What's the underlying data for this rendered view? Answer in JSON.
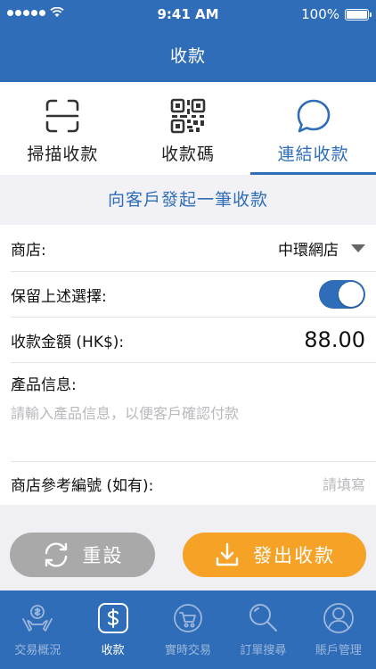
{
  "status_bar": {
    "time": "9:41 AM",
    "battery": "100%"
  },
  "nav": {
    "title": "收款"
  },
  "tabs": [
    {
      "label": "掃描收款",
      "icon": "scan-icon",
      "active": false
    },
    {
      "label": "收款碼",
      "icon": "qr-code-icon",
      "active": false
    },
    {
      "label": "連結收款",
      "icon": "chat-bubble-icon",
      "active": true
    }
  ],
  "section": {
    "title": "向客戶發起一筆收款"
  },
  "form": {
    "shop_label": "商店:",
    "shop_value": "中環網店",
    "keep_label": "保留上述選擇:",
    "keep_on": true,
    "amount_label": "收款金額 (HK$):",
    "amount_value": "88.00",
    "product_label": "產品信息:",
    "product_placeholder": "請輸入產品信息，以便客戶確認付款",
    "ref_label": "商店參考編號 (如有):",
    "ref_placeholder": "請填寫"
  },
  "buttons": {
    "reset": "重設",
    "send": "發出收款"
  },
  "tabbar": [
    {
      "label": "交易概況",
      "icon": "hand-coin-icon",
      "active": false
    },
    {
      "label": "收款",
      "icon": "dollar-card-icon",
      "active": true
    },
    {
      "label": "實時交易",
      "icon": "cart-sync-icon",
      "active": false
    },
    {
      "label": "訂單搜尋",
      "icon": "search-icon",
      "active": false
    },
    {
      "label": "賬戶管理",
      "icon": "user-icon",
      "active": false
    }
  ],
  "colors": {
    "primary": "#2f6db8",
    "accent": "#f5a227",
    "disabled": "#a9a9a9"
  }
}
